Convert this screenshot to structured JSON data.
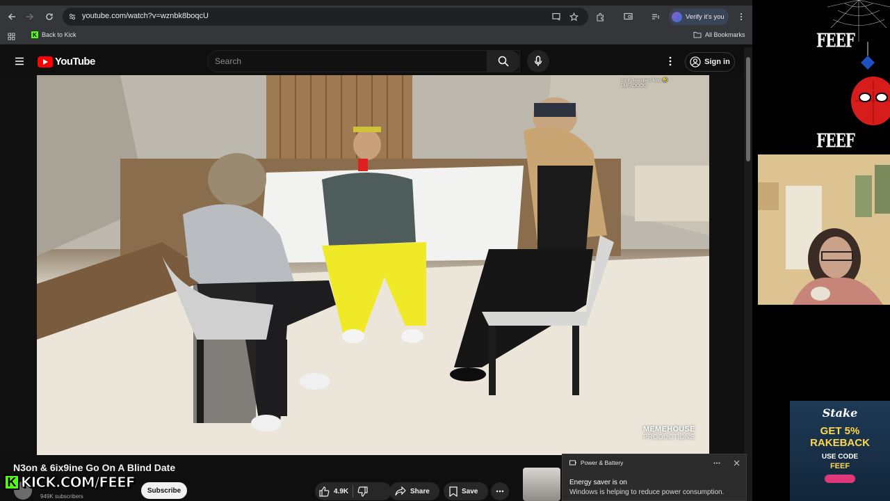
{
  "browser": {
    "url": "youtube.com/watch?v=wznbk8boqcU",
    "verify_label": "Verify it's you",
    "bookmark_back": "Back to Kick",
    "bookmark_all": "All Bookmarks"
  },
  "youtube": {
    "logo_text": "YouTube",
    "search_placeholder": "Search",
    "sign_in": "Sign in"
  },
  "video": {
    "title": "N3on & 6ix9ine Go On A Blind Date",
    "chat_lines": [
      "dont disrespect king 🤣",
      "LMFAOOOO"
    ],
    "watermark_line1": "MEMEHOUSE",
    "watermark_line2": "PRODUCTIONS"
  },
  "channel": {
    "subscribers": "949K subscribers",
    "subscribe_label": "Subscribe"
  },
  "actions": {
    "likes": "4.9K",
    "share": "Share",
    "save": "Save"
  },
  "notification": {
    "app": "Power & Battery",
    "title": "Energy saver is on",
    "body": "Windows is helping to reduce power consumption."
  },
  "stream_overlay": {
    "logo_text": "FEEF",
    "kick_text": "KICK.COM/FEEF",
    "stake_logo": "Stake",
    "stake_offer_1": "GET 5%",
    "stake_offer_2": "RAKEBACK",
    "stake_code_label": "USE CODE",
    "stake_code": "FEEF",
    "accent_kick": "#53fc18",
    "accent_youtube": "#ff0000"
  }
}
